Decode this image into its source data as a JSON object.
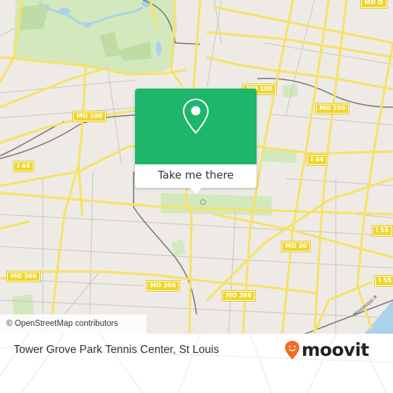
{
  "map": {
    "attribution": "© OpenStreetMap contributors",
    "river_label": "Mississippi R",
    "road_shields": [
      {
        "id": "mo-d",
        "label": "MO D"
      },
      {
        "id": "mo-100-west",
        "label": "MO 100"
      },
      {
        "id": "mo-100-center",
        "label": "MO 100"
      },
      {
        "id": "mo-100-east",
        "label": "MO 100"
      },
      {
        "id": "i-44-west",
        "label": "I 44"
      },
      {
        "id": "i-44-east",
        "label": "I 44"
      },
      {
        "id": "i-55-north",
        "label": "I 55"
      },
      {
        "id": "i-55-south",
        "label": "I 55"
      },
      {
        "id": "mo-30",
        "label": "MO 30"
      },
      {
        "id": "mo-366-west",
        "label": "MO 366"
      },
      {
        "id": "mo-366-center",
        "label": "MO 366"
      },
      {
        "id": "mo-366-east",
        "label": "MO 366"
      }
    ],
    "colors": {
      "land": "#eeebe6",
      "park": "#d3e8bd",
      "water": "#a9d3ea",
      "major_road": "#f5e26a",
      "minor_road": "#c9c4be",
      "rail": "#777777",
      "shield": "#f0d62a"
    }
  },
  "popup": {
    "icon": "location-pin-icon",
    "button_label": "Take me there",
    "accent": "#1db66a"
  },
  "footer": {
    "place_name": "Tower Grove Park Tennis Center, St Louis",
    "brand": "moovit",
    "brand_color": "#f26b21"
  }
}
